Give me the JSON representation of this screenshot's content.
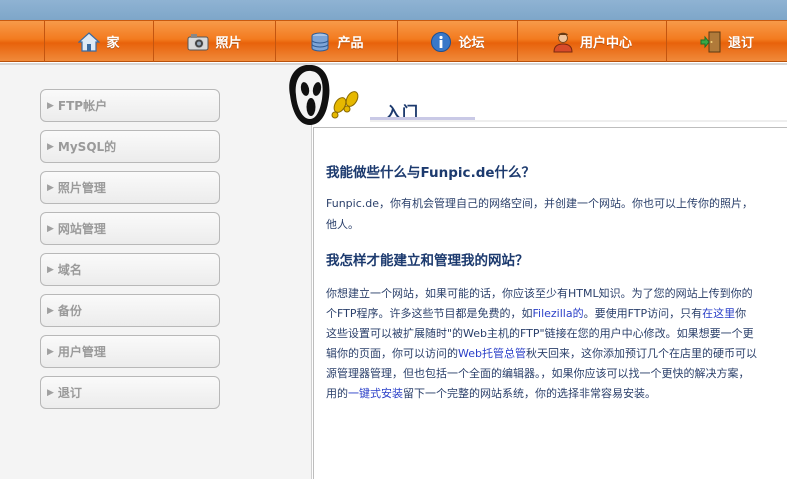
{
  "nav": {
    "items": [
      {
        "label": "家",
        "icon": "home-icon"
      },
      {
        "label": "照片",
        "icon": "camera-icon"
      },
      {
        "label": "产品",
        "icon": "database-icon"
      },
      {
        "label": "论坛",
        "icon": "info-icon"
      },
      {
        "label": "用户中心",
        "icon": "user-icon"
      },
      {
        "label": "退订",
        "icon": "exit-door-icon"
      }
    ]
  },
  "sidebar": {
    "items": [
      {
        "label": "FTP帐户"
      },
      {
        "label": "MySQL的"
      },
      {
        "label": "照片管理"
      },
      {
        "label": "网站管理"
      },
      {
        "label": "域名"
      },
      {
        "label": "备份"
      },
      {
        "label": "用户管理"
      },
      {
        "label": "退订"
      }
    ]
  },
  "main": {
    "title": "入门",
    "section1": {
      "heading": "我能做些什么与Funpic.de什么？",
      "line1": "Funpic.de，你有机会管理自己的网络空间，并创建一个网站。你也可以上传你的照片，",
      "line2": "他人。"
    },
    "section2": {
      "heading": "我怎样才能建立和管理我的网站？",
      "l1a": "你想建立一个网站，如果可能的话，你应该至少有",
      "l1b": "HTML",
      "l1c": "知识。为了您的网站上传到你的",
      "l2a": "个FTP程序。许多这些节目都是免费的，如",
      "l2b": "Filezilla的",
      "l2c": "。要使用FTP访问，只有",
      "l2d": "在这里",
      "l2e": "你",
      "l3": "这些设置可以被扩展随时\"的Web主机的FTP\"链接在您的用户中心修改。如果想要一个更",
      "l4a": "辑你的页面，你可以访问的",
      "l4b": "Web托管总管",
      "l4c": "秋天回来，这你添加预订几个在店里的硬币可以",
      "l5": "源管理器管理，但也包括一个全面的编辑器。，如果你应该可以找一个更快的解决方案，",
      "l6a": "用的",
      "l6b": "一键式安装",
      "l6c": "留下一个完整的网站系统，你的选择非常容易安装。"
    }
  }
}
